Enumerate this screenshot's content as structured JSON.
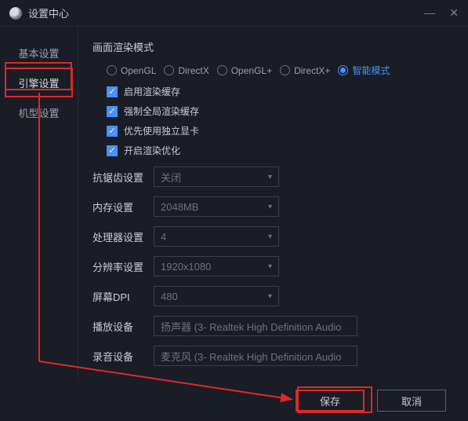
{
  "titlebar": {
    "title": "设置中心"
  },
  "sidebar": {
    "items": [
      {
        "label": "基本设置"
      },
      {
        "label": "引擎设置"
      },
      {
        "label": "机型设置"
      }
    ]
  },
  "content": {
    "render_mode_title": "画面渲染模式",
    "render_modes": [
      {
        "label": "OpenGL"
      },
      {
        "label": "DirectX"
      },
      {
        "label": "OpenGL+"
      },
      {
        "label": "DirectX+"
      },
      {
        "label": "智能模式"
      }
    ],
    "checks": [
      {
        "label": "启用渲染缓存"
      },
      {
        "label": "强制全局渲染缓存"
      },
      {
        "label": "优先使用独立显卡"
      },
      {
        "label": "开启渲染优化"
      }
    ],
    "rows": {
      "antialias": {
        "label": "抗锯齿设置",
        "value": "关闭"
      },
      "memory": {
        "label": "内存设置",
        "value": "2048MB"
      },
      "cpu": {
        "label": "处理器设置",
        "value": "4"
      },
      "resolution": {
        "label": "分辨率设置",
        "value": "1920x1080"
      },
      "dpi": {
        "label": "屏幕DPI",
        "value": "480"
      },
      "playback": {
        "label": "播放设备",
        "value": "扬声器 (3- Realtek High Definition Audio"
      },
      "record": {
        "label": "录音设备",
        "value": "麦克风 (3- Realtek High Definition Audio"
      }
    }
  },
  "footer": {
    "save": "保存",
    "cancel": "取消"
  }
}
